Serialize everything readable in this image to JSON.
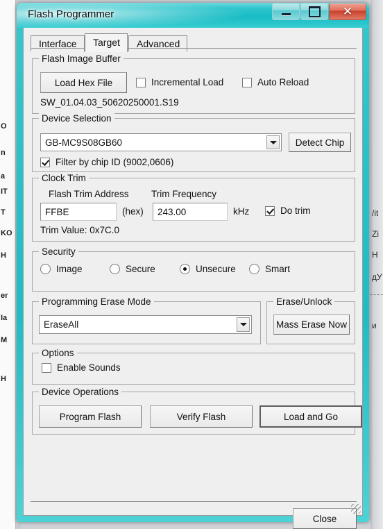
{
  "window": {
    "title": "Flash Programmer",
    "caption_buttons": [
      {
        "name": "minimize",
        "glyph": "minimize-icon"
      },
      {
        "name": "maximize",
        "glyph": "maximize-icon"
      },
      {
        "name": "close",
        "glyph": "✕"
      }
    ],
    "accent_color": "#1fbcc4",
    "close_button_color": "#c9402b"
  },
  "tabs": [
    {
      "label": "Interface",
      "selected": false
    },
    {
      "label": "Target",
      "selected": true
    },
    {
      "label": "Advanced",
      "selected": false
    }
  ],
  "flash_image_buffer": {
    "group_title": "Flash Image Buffer",
    "load_hex_file_label": "Load Hex File",
    "incremental_load": {
      "label": "Incremental Load",
      "checked": false
    },
    "auto_reload": {
      "label": "Auto Reload",
      "checked": false
    },
    "file_name": "SW_01.04.03_50620250001.S19"
  },
  "device_selection": {
    "group_title": "Device Selection",
    "device_value": "GB-MC9S08GB60",
    "detect_chip_label": "Detect Chip",
    "filter_by_chip_id": {
      "label": "Filter by chip ID (9002,0606)",
      "checked": true
    }
  },
  "clock_trim": {
    "group_title": "Clock Trim",
    "flash_trim_address_label": "Flash Trim Address",
    "flash_trim_address_value": "FFBE",
    "hex_suffix": "(hex)",
    "trim_frequency_label": "Trim Frequency",
    "trim_frequency_value": "243.00",
    "frequency_unit": "kHz",
    "do_trim": {
      "label": "Do trim",
      "checked": true
    },
    "trim_value_text": "Trim Value: 0x7C.0"
  },
  "security": {
    "group_title": "Security",
    "options": [
      {
        "label": "Image",
        "selected": false
      },
      {
        "label": "Secure",
        "selected": false
      },
      {
        "label": "Unsecure",
        "selected": true
      },
      {
        "label": "Smart",
        "selected": false
      }
    ]
  },
  "erase_mode": {
    "group_title": "Programming Erase Mode",
    "value": "EraseAll"
  },
  "erase_unlock": {
    "group_title": "Erase/Unlock",
    "mass_erase_label": "Mass Erase Now"
  },
  "options": {
    "group_title": "Options",
    "enable_sounds": {
      "label": "Enable Sounds",
      "checked": false
    }
  },
  "device_operations": {
    "group_title": "Device Operations",
    "buttons": [
      {
        "label": "Program Flash",
        "default": false
      },
      {
        "label": "Verify Flash",
        "default": false
      },
      {
        "label": "Load and Go",
        "default": true
      }
    ]
  },
  "footer": {
    "close_label": "Close"
  },
  "background": {
    "left_fragments": [
      "O",
      "IT",
      "n",
      "a",
      "T",
      "KO",
      "H",
      "er",
      "Ia",
      "M",
      "H"
    ],
    "right_fragments": [
      "/it",
      "Zi",
      "H",
      "дУ",
      "и"
    ]
  }
}
